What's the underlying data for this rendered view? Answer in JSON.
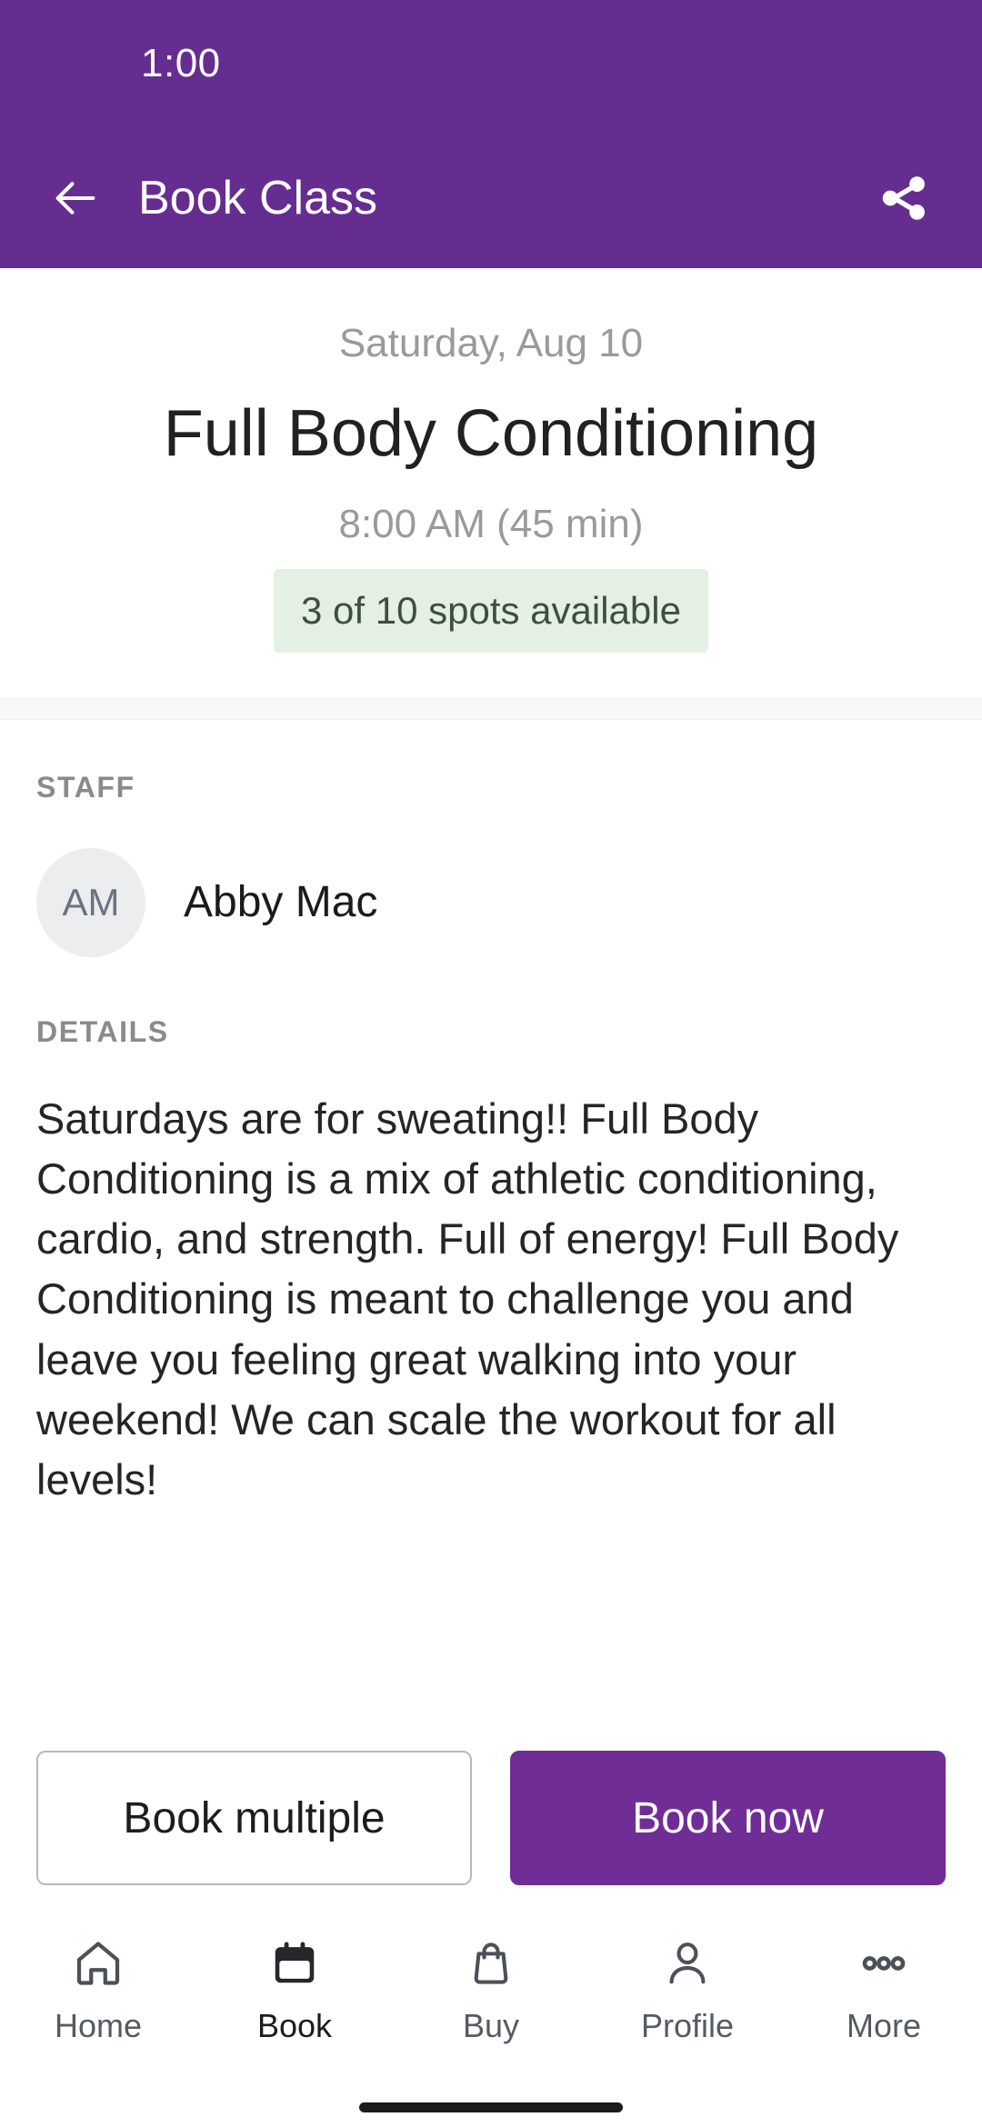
{
  "status_bar": {
    "time": "1:00"
  },
  "app_bar": {
    "title": "Book Class",
    "back_icon": "arrow-left-icon",
    "share_icon": "share-icon"
  },
  "hero": {
    "date": "Saturday, Aug 10",
    "class_title": "Full Body Conditioning",
    "time": "8:00 AM (45 min)",
    "spots_badge": "3 of 10 spots available",
    "spots_available": 3,
    "spots_total": 10
  },
  "staff_section": {
    "label": "STAFF",
    "members": [
      {
        "initials": "AM",
        "name": "Abby Mac"
      }
    ]
  },
  "details_section": {
    "label": "DETAILS",
    "text": "Saturdays are for sweating!! Full Body Conditioning is a mix of athletic conditioning, cardio, and strength.  Full of energy! Full Body Conditioning is meant to challenge you and leave you feeling great walking into your weekend! We can scale the workout for all levels!"
  },
  "actions": {
    "secondary_label": "Book multiple",
    "primary_label": "Book now"
  },
  "bottom_nav": {
    "items": [
      {
        "label": "Home",
        "icon": "home-icon",
        "active": false
      },
      {
        "label": "Book",
        "icon": "calendar-icon",
        "active": true
      },
      {
        "label": "Buy",
        "icon": "shopping-bag-icon",
        "active": false
      },
      {
        "label": "Profile",
        "icon": "person-icon",
        "active": false
      },
      {
        "label": "More",
        "icon": "ellipsis-icon",
        "active": false
      }
    ]
  },
  "colors": {
    "brand_purple": "#662D91",
    "button_purple": "#702D96",
    "badge_bg": "#E4F0E3",
    "badge_text": "#3E4F3E",
    "muted_text": "#9A9A9A",
    "avatar_bg": "#ECEDEF"
  }
}
